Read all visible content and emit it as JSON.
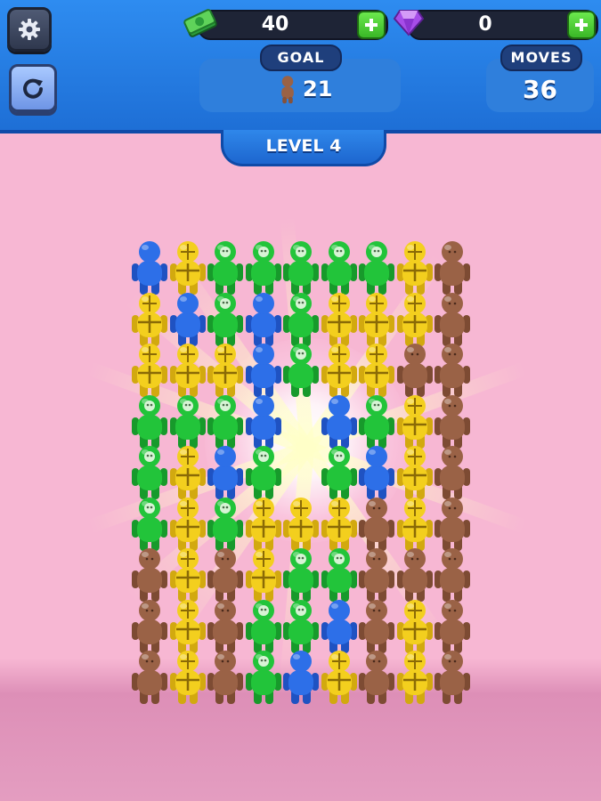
{
  "header": {
    "cash": {
      "value": "40",
      "icon": "cash-stack-icon"
    },
    "gems": {
      "value": "0",
      "icon": "purple-gem-icon"
    },
    "goal": {
      "label": "GOAL",
      "count": "21",
      "icon": "brown-figure-icon"
    },
    "moves": {
      "label": "MOVES",
      "count": "36"
    },
    "settings_icon": "gear-icon",
    "restart_icon": "refresh-icon"
  },
  "level": {
    "label": "LEVEL 4"
  },
  "colors": {
    "blue": "#2d6fe8",
    "yellow": "#f3cf1e",
    "green": "#22c43a",
    "brown": "#9a6246",
    "header_blue": "#2e8cf0",
    "background_pink": "#f7b7d3"
  },
  "board": {
    "columns": 9,
    "rows": 9,
    "cells": [
      [
        "blue",
        "yellow",
        "green",
        "green",
        "green",
        "green",
        "green",
        "yellow",
        "brown"
      ],
      [
        "yellow",
        "blue",
        "green",
        "blue",
        "green",
        "yellow",
        "yellow",
        "yellow",
        "brown"
      ],
      [
        "yellow",
        "yellow",
        "yellow",
        "blue",
        "green",
        "yellow",
        "yellow",
        "brown",
        "brown"
      ],
      [
        "green",
        "green",
        "green",
        "blue",
        "",
        "blue",
        "green",
        "yellow",
        "brown"
      ],
      [
        "green",
        "yellow",
        "blue",
        "green",
        "",
        "green",
        "blue",
        "yellow",
        "brown"
      ],
      [
        "green",
        "yellow",
        "green",
        "yellow",
        "yellow",
        "yellow",
        "brown",
        "yellow",
        "brown"
      ],
      [
        "brown",
        "yellow",
        "brown",
        "yellow",
        "green",
        "green",
        "brown",
        "brown",
        "brown"
      ],
      [
        "brown",
        "yellow",
        "brown",
        "green",
        "green",
        "blue",
        "brown",
        "yellow",
        "brown"
      ],
      [
        "brown",
        "yellow",
        "brown",
        "green",
        "blue",
        "yellow",
        "brown",
        "yellow",
        "brown"
      ]
    ]
  }
}
